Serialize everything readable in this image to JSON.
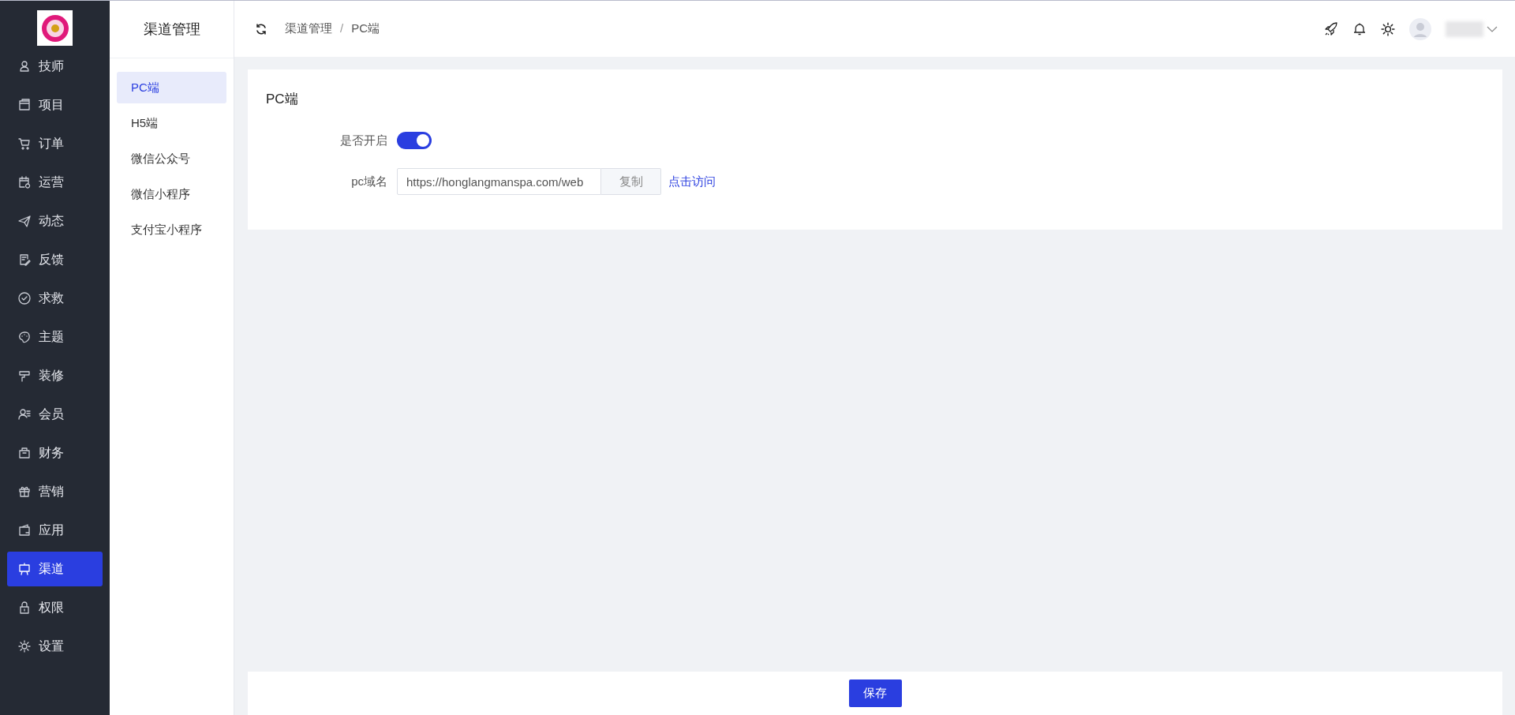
{
  "sidebar": {
    "items": [
      {
        "label": "技师",
        "selected": false
      },
      {
        "label": "项目",
        "selected": false
      },
      {
        "label": "订单",
        "selected": false
      },
      {
        "label": "运营",
        "selected": false
      },
      {
        "label": "动态",
        "selected": false
      },
      {
        "label": "反馈",
        "selected": false
      },
      {
        "label": "求救",
        "selected": false
      },
      {
        "label": "主题",
        "selected": false
      },
      {
        "label": "装修",
        "selected": false
      },
      {
        "label": "会员",
        "selected": false
      },
      {
        "label": "财务",
        "selected": false
      },
      {
        "label": "营销",
        "selected": false
      },
      {
        "label": "应用",
        "selected": false
      },
      {
        "label": "渠道",
        "selected": true
      },
      {
        "label": "权限",
        "selected": false
      },
      {
        "label": "设置",
        "selected": false
      }
    ]
  },
  "subnav": {
    "title": "渠道管理",
    "items": [
      {
        "label": "PC端",
        "selected": true
      },
      {
        "label": "H5端",
        "selected": false
      },
      {
        "label": "微信公众号",
        "selected": false
      },
      {
        "label": "微信小程序",
        "selected": false
      },
      {
        "label": "支付宝小程序",
        "selected": false
      }
    ]
  },
  "breadcrumb": {
    "items": [
      "渠道管理",
      "PC端"
    ],
    "separator": "/"
  },
  "card": {
    "title": "PC端",
    "enable": {
      "label": "是否开启",
      "on": true
    },
    "domain": {
      "label": "pc域名",
      "value": "https://honglangmanspa.com/web",
      "copy": "复制",
      "link": "点击访问"
    }
  },
  "footer": {
    "save": "保存"
  }
}
